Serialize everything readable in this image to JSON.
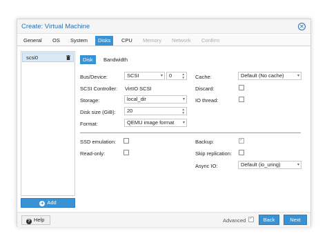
{
  "dialog": {
    "title": "Create: Virtual Machine",
    "close_icon": "close-icon"
  },
  "tabs": [
    {
      "label": "General",
      "state": "normal"
    },
    {
      "label": "OS",
      "state": "normal"
    },
    {
      "label": "System",
      "state": "normal"
    },
    {
      "label": "Disks",
      "state": "active"
    },
    {
      "label": "CPU",
      "state": "normal"
    },
    {
      "label": "Memory",
      "state": "disabled"
    },
    {
      "label": "Network",
      "state": "disabled"
    },
    {
      "label": "Confirm",
      "state": "disabled"
    }
  ],
  "disk_list": {
    "items": [
      {
        "label": "scsi0",
        "icon": "trash-icon"
      }
    ],
    "add_label": "Add",
    "add_icon": "plus-icon"
  },
  "subtabs": [
    {
      "label": "Disk",
      "state": "active"
    },
    {
      "label": "Bandwidth",
      "state": "normal"
    }
  ],
  "form": {
    "bus_device": {
      "label": "Bus/Device:",
      "bus_value": "SCSI",
      "device_value": "0"
    },
    "scsi_controller": {
      "label": "SCSI Controller:",
      "value": "VirtIO SCSI"
    },
    "storage": {
      "label": "Storage:",
      "value": "local_dir"
    },
    "disk_size": {
      "label": "Disk size (GiB):",
      "value": "20"
    },
    "format": {
      "label": "Format:",
      "value": "QEMU image format"
    },
    "cache": {
      "label": "Cache:",
      "value": "Default (No cache)"
    },
    "discard": {
      "label": "Discard:",
      "checked": false
    },
    "io_thread": {
      "label": "IO thread:",
      "checked": false
    },
    "ssd_emulation": {
      "label": "SSD emulation:",
      "checked": false
    },
    "read_only": {
      "label": "Read-only:",
      "checked": false
    },
    "backup": {
      "label": "Backup:",
      "checked": true
    },
    "skip_replication": {
      "label": "Skip replication:",
      "checked": false
    },
    "async_io": {
      "label": "Async IO:",
      "value": "Default (io_uring)"
    }
  },
  "footer": {
    "help_label": "Help",
    "help_icon": "help-icon",
    "advanced_label": "Advanced",
    "advanced_checked": true,
    "back_label": "Back",
    "next_label": "Next"
  },
  "colors": {
    "accent": "#3892d4",
    "title": "#2c6fb3"
  }
}
